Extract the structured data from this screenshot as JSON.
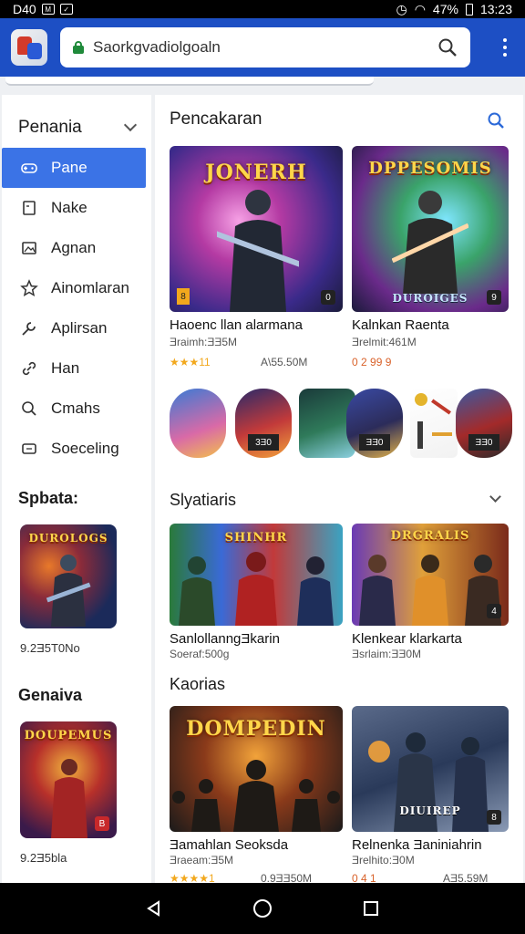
{
  "status_bar": {
    "time_left": "D40",
    "battery": "47%",
    "clock": "13:23"
  },
  "browser": {
    "url": "Saorkgvadiolgoaln"
  },
  "sidebar": {
    "header": "Penania",
    "items": [
      {
        "label": "Pane",
        "icon": "gamepad-icon",
        "active": true
      },
      {
        "label": "Nake",
        "icon": "document-icon",
        "active": false
      },
      {
        "label": "Agnan",
        "icon": "image-icon",
        "active": false
      },
      {
        "label": "Ainomlaran",
        "icon": "star-icon",
        "active": false
      },
      {
        "label": "Aplirsan",
        "icon": "wrench-icon",
        "active": false
      },
      {
        "label": "Han",
        "icon": "link-icon",
        "active": false
      },
      {
        "label": "Cmahs",
        "icon": "search-icon",
        "active": false
      },
      {
        "label": "Soeceling",
        "icon": "chat-icon",
        "active": false
      }
    ],
    "section1": {
      "title": "Spbata:",
      "caption": "9.2Ǝ5T0No"
    },
    "section2": {
      "title": "Genaiva",
      "caption": "9.2Ǝ5bla"
    }
  },
  "main": {
    "heading": "Pencakaran",
    "featured": [
      {
        "art_title": "JONERH",
        "title": "Haoenc llan alarmana",
        "sub": "Ǝraimh:ƎƎ5M",
        "rating": "★★★11",
        "meta": "A\\55.50M",
        "badge": "0"
      },
      {
        "art_title": "DPPESOMIS",
        "art_sub": "DUROIGES",
        "title": "Kalnkan Raenta",
        "sub": "Ǝrelmit:461M",
        "rating": "0 2 99 9",
        "meta": "",
        "badge": "9"
      }
    ],
    "mini_badges": [
      "",
      "3Ǝ0",
      "",
      "ƎƎ0",
      "",
      "ƎƎ0"
    ],
    "section1": {
      "title": "Slyatiaris",
      "cards": [
        {
          "art_title": "SHINHR",
          "title": "SanlollanngƎkarin",
          "sub": "Soeraf:500g",
          "badge": ""
        },
        {
          "art_title": "DRGRALIS",
          "title": "Klenkear klarkarta",
          "sub": "Ǝsrlaim:ƎƎ0M",
          "badge": "4"
        }
      ]
    },
    "section2": {
      "title": "Kaorias",
      "cards": [
        {
          "art_title": "DOMPEDIN",
          "title": "Ǝamahlan Seoksda",
          "sub": "Ǝraeam:Ǝ5M",
          "rating": "★★★★1",
          "meta": "0.9ƎƎ50M",
          "badge": ""
        },
        {
          "art_title": "DIUIREP",
          "title": "Relnenka Ǝaniniahrin",
          "sub": "Ǝrelhito:Ǝ0M",
          "rating": "0 4 1",
          "meta": "AƎ5.59M",
          "badge": "8"
        }
      ]
    }
  }
}
